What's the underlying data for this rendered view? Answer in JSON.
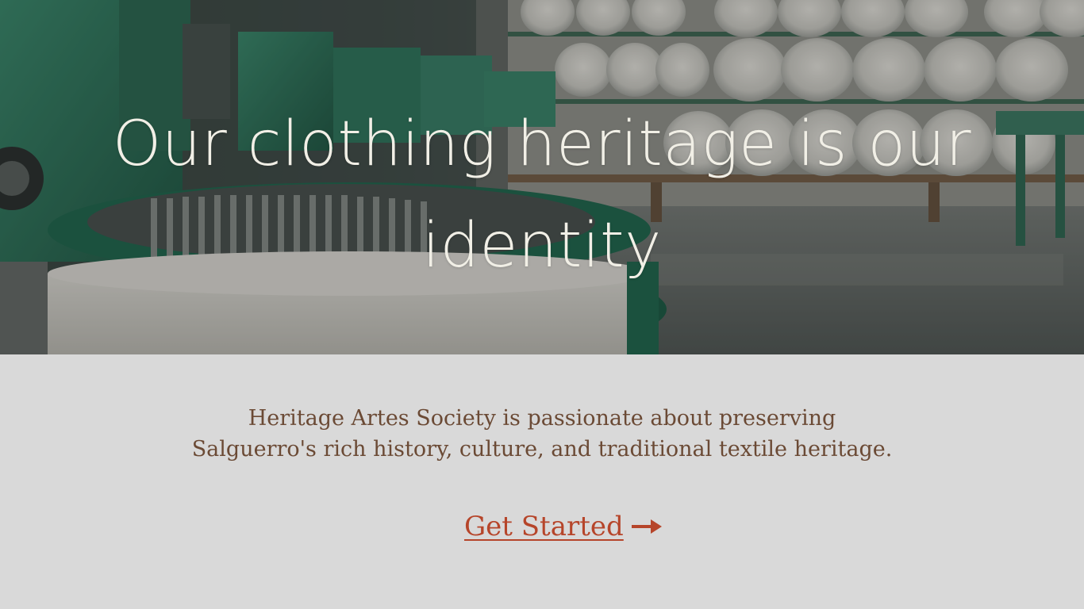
{
  "hero": {
    "title": "Our clothing heritage is our identity",
    "background_image": "textile-factory-knitting-machines-photo"
  },
  "intro": {
    "line1": "Heritage Artes Society is passionate about preserving",
    "line2": "Salguerro's rich history, culture, and traditional textile heritage."
  },
  "cta": {
    "label": "Get Started",
    "icon": "arrow-right-icon"
  },
  "colors": {
    "hero_text": "#f1efe6",
    "body_background": "#d9d9d9",
    "tagline_text": "#6b4a35",
    "cta_accent": "#b6452a",
    "machine_green": "#2f7a5f"
  }
}
